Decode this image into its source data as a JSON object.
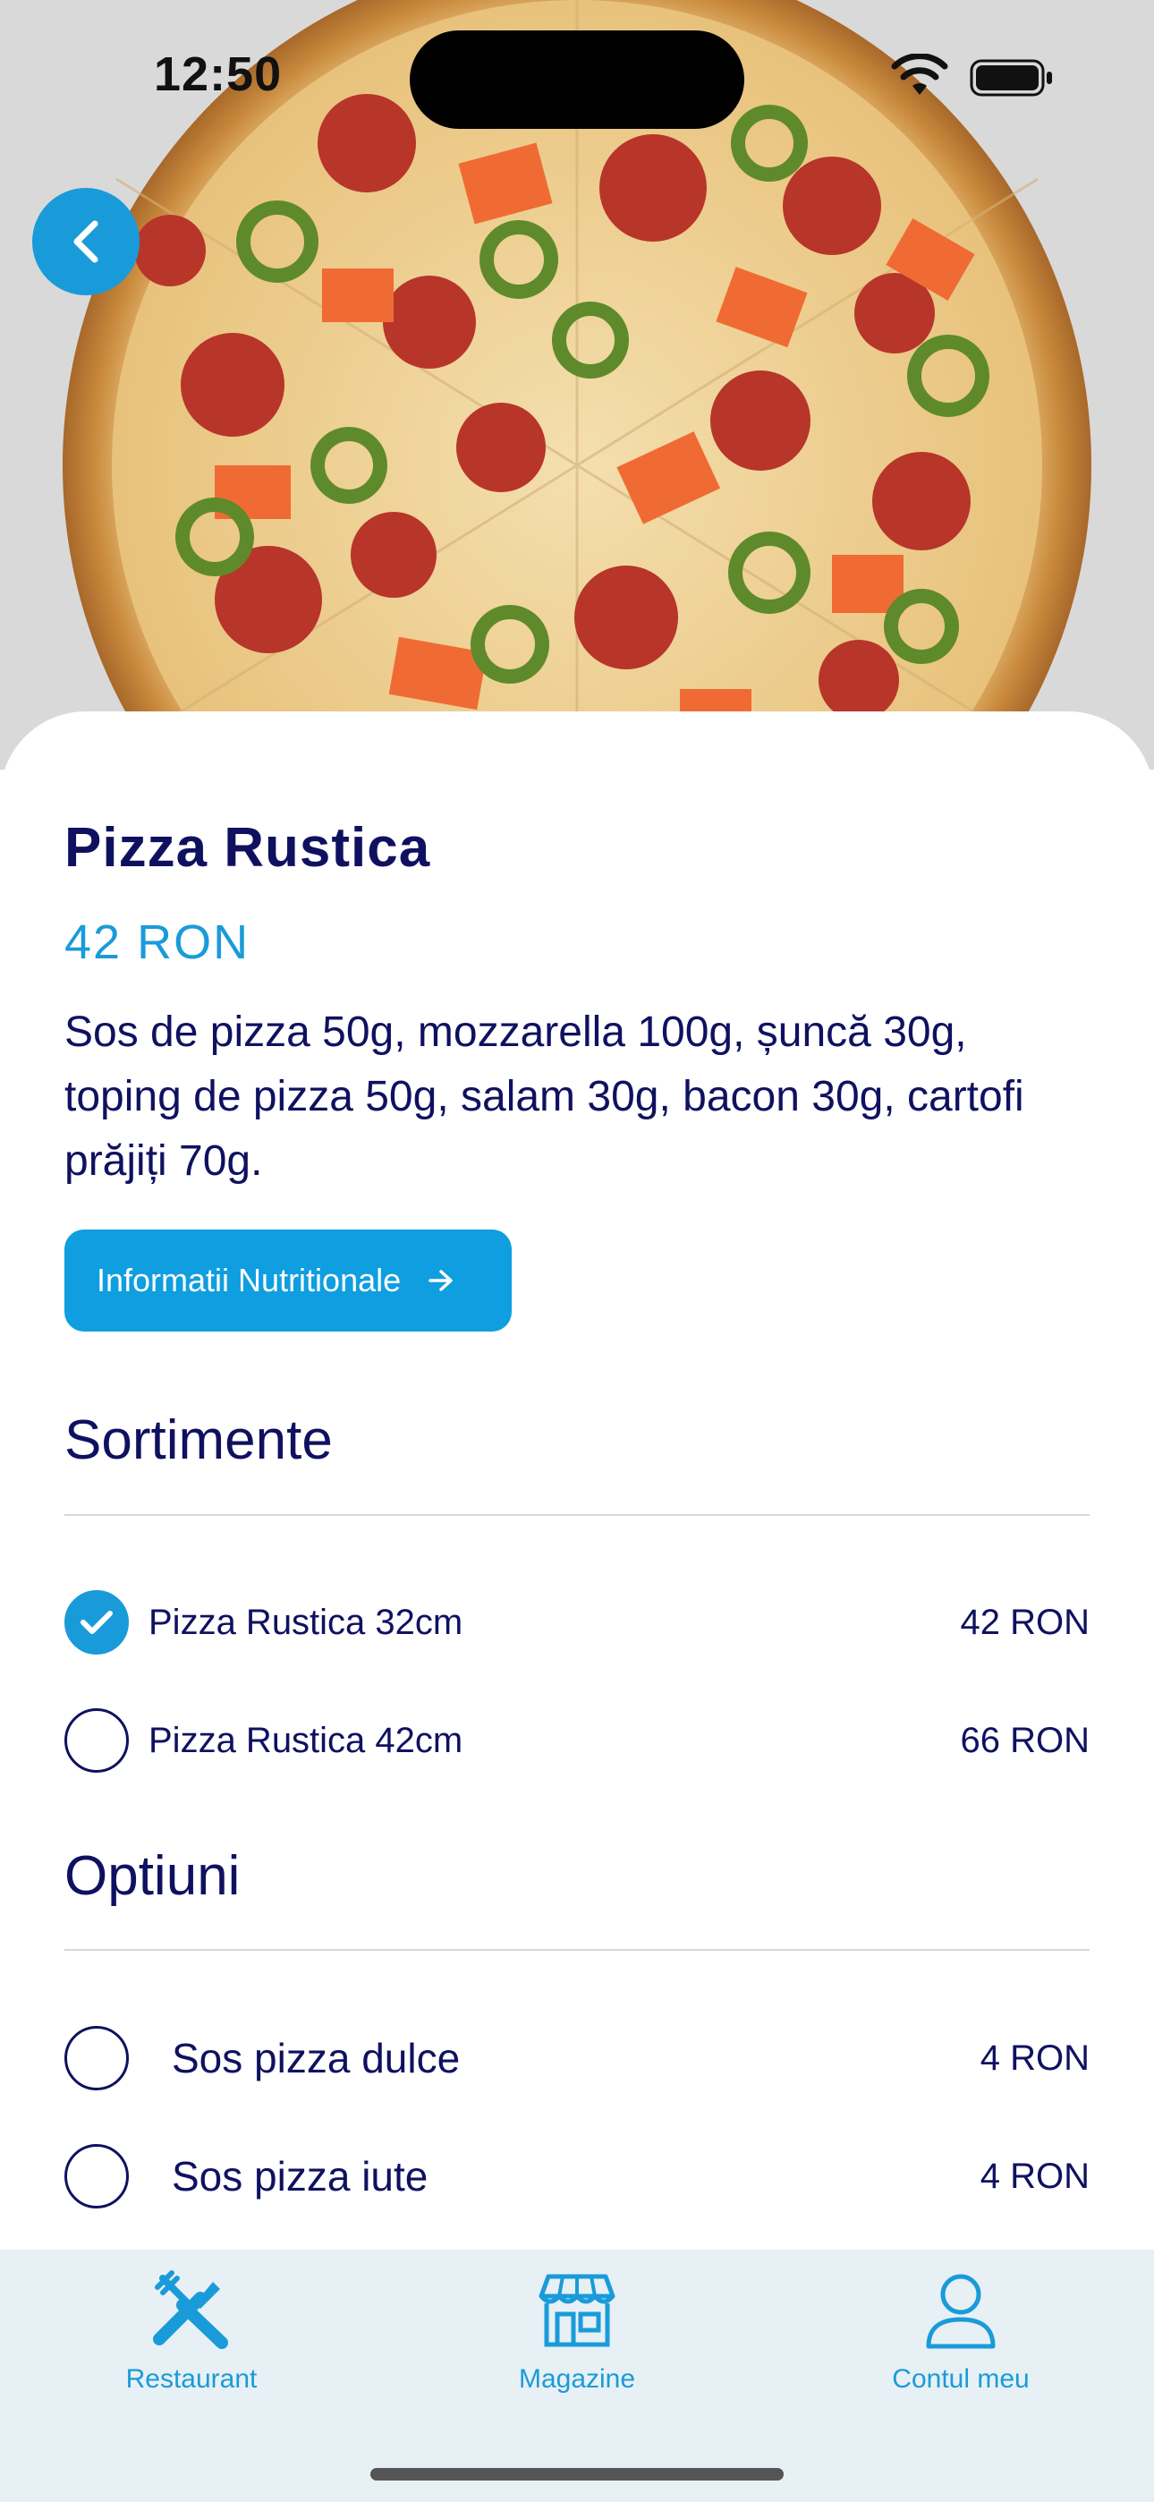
{
  "status_bar": {
    "time": "12:50"
  },
  "product": {
    "name": "Pizza Rustica",
    "price": "42 RON",
    "description": "Sos de pizza 50g, mozzarella 100g, șuncă 30g, toping de pizza 50g, salam 30g, bacon 30g, cartofi prăjiți 70g.",
    "nutrition_button": "Informatii Nutritionale"
  },
  "sortimente": {
    "title": "Sortimente",
    "items": [
      {
        "label": "Pizza Rustica 32cm",
        "price": "42 RON",
        "selected": true
      },
      {
        "label": "Pizza Rustica 42cm",
        "price": "66 RON",
        "selected": false
      }
    ]
  },
  "optiuni": {
    "title": "Optiuni",
    "items": [
      {
        "label": "Sos pizza dulce",
        "price": "4 RON",
        "selected": false
      },
      {
        "label": "Sos pizza iute",
        "price": "4 RON",
        "selected": false
      }
    ]
  },
  "bottom_nav": {
    "items": [
      {
        "label": "Restaurant",
        "icon": "fork-knife-icon"
      },
      {
        "label": "Magazine",
        "icon": "store-icon"
      },
      {
        "label": "Contul meu",
        "icon": "user-icon"
      }
    ]
  },
  "colors": {
    "accent": "#1a9bd9",
    "text_primary": "#0f1160",
    "nav_background": "#e7f0f5"
  }
}
